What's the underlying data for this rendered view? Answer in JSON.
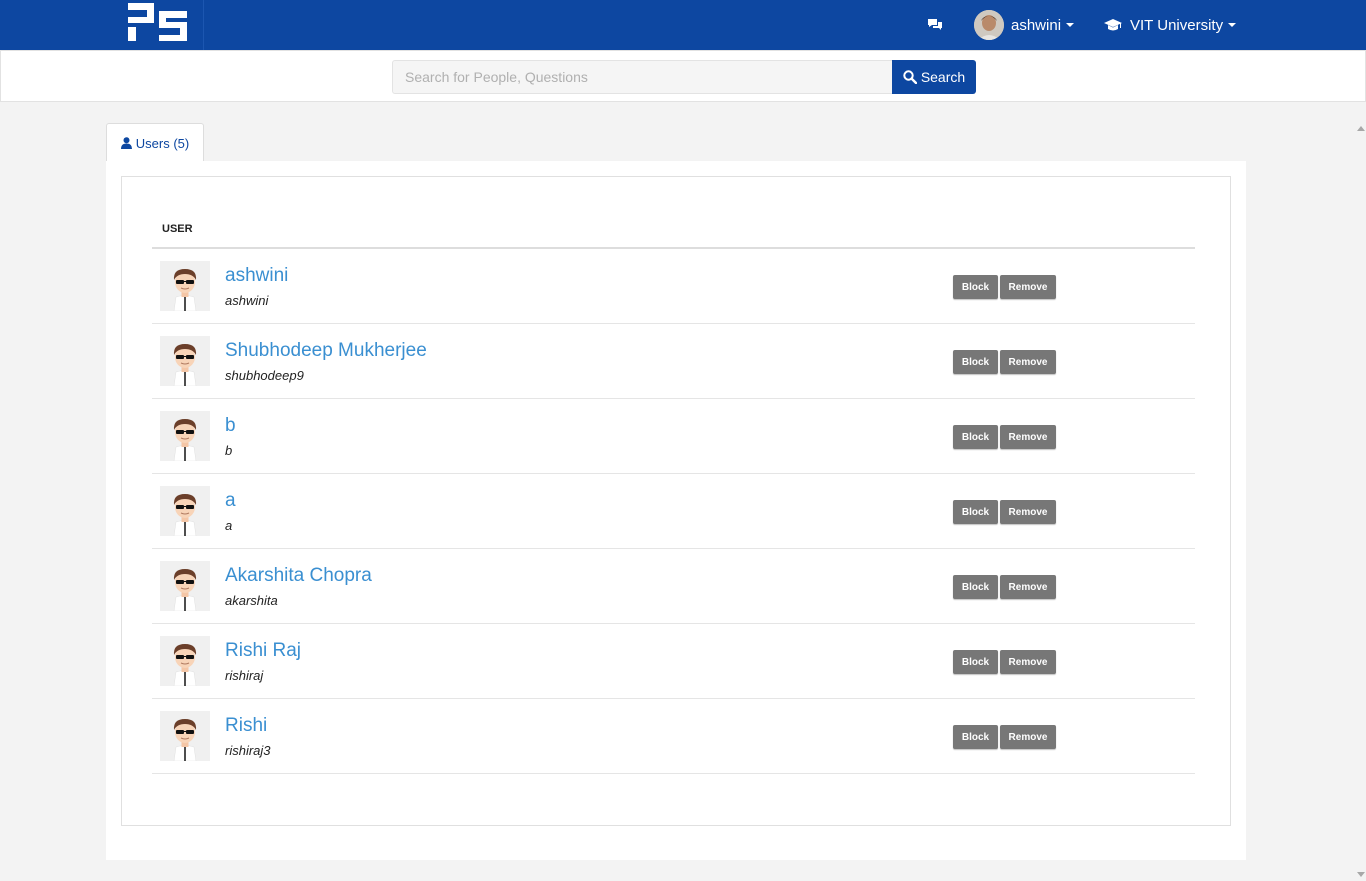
{
  "nav": {
    "logo_icon": "brand-logo",
    "chat_icon": "comments-icon",
    "user_name": "ashwini",
    "university": "VIT University",
    "university_icon": "graduation-cap-icon",
    "color_primary": "#0d47a1"
  },
  "search": {
    "placeholder": "Search for People, Questions",
    "value": "",
    "button_label": "Search",
    "button_icon": "search-icon"
  },
  "tabs": [
    {
      "label": "Users (5)",
      "icon": "user-icon",
      "active": true
    }
  ],
  "table": {
    "header": "USER",
    "block_label": "Block",
    "remove_label": "Remove",
    "rows": [
      {
        "name": "ashwini",
        "username": "ashwini"
      },
      {
        "name": "Shubhodeep Mukherjee",
        "username": "shubhodeep9"
      },
      {
        "name": "b",
        "username": "b"
      },
      {
        "name": "a",
        "username": "a"
      },
      {
        "name": "Akarshita Chopra",
        "username": "akarshita"
      },
      {
        "name": "Rishi Raj",
        "username": "rishiraj"
      },
      {
        "name": "Rishi",
        "username": "rishiraj3"
      }
    ]
  }
}
